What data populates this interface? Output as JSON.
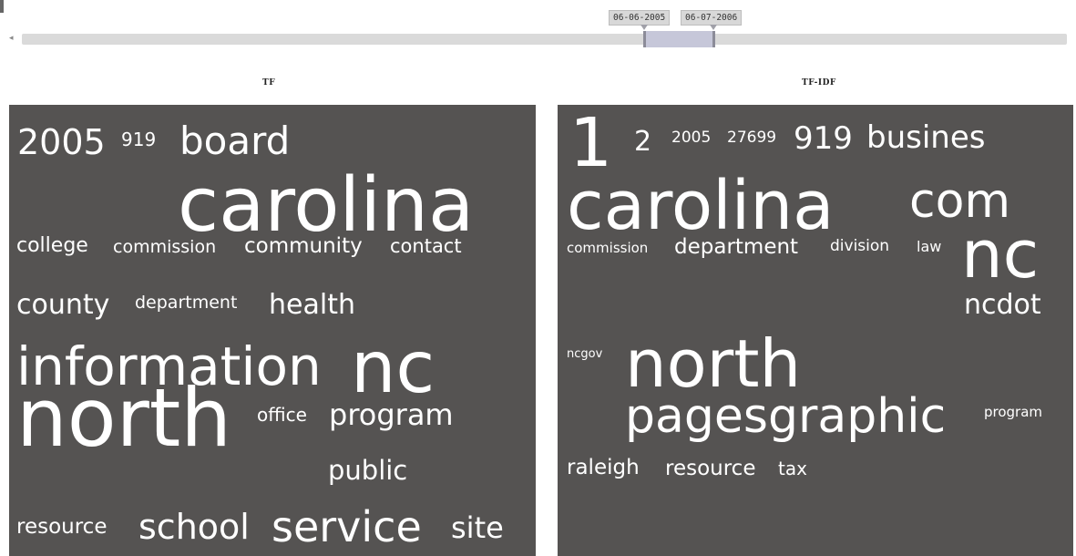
{
  "timeline": {
    "start_date": "06-06-2005",
    "end_date": "06-07-2006",
    "left_arrow": "◂"
  },
  "tf_panel": {
    "title": "TF",
    "words": [
      "2005",
      "919",
      "board",
      "carolina",
      "college",
      "commission",
      "community",
      "contact",
      "county",
      "department",
      "health",
      "information",
      "nc",
      "north",
      "office",
      "program",
      "public",
      "resource",
      "school",
      "service",
      "site"
    ]
  },
  "tfidf_panel": {
    "title": "TF-IDF",
    "words": [
      "1",
      "2",
      "2005",
      "27699",
      "919",
      "busines",
      "carolina",
      "com",
      "commission",
      "department",
      "division",
      "law",
      "nc",
      "ncdot",
      "ncgov",
      "north",
      "pagesgraphic",
      "program",
      "raleigh",
      "resource",
      "tax"
    ]
  },
  "colors": {
    "cloud_background": "#555352",
    "word_color": "#ffffff",
    "track": "#dadada",
    "selection": "#c6c7d9"
  }
}
